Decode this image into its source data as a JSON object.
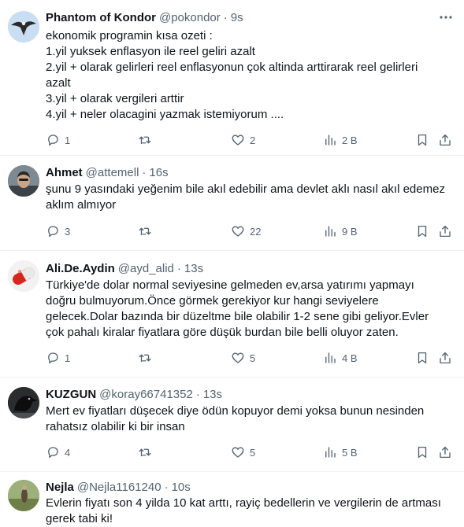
{
  "icons": {
    "more": "more-dots-icon",
    "reply": "reply-bubble-icon",
    "retweet": "retweet-icon",
    "like": "heart-icon",
    "views": "views-bars-icon",
    "bookmark": "bookmark-icon",
    "share": "share-upload-icon"
  },
  "colors": {
    "text": "#0f1419",
    "muted": "#536471",
    "divider": "#eff3f4"
  },
  "tweets": [
    {
      "name": "Phantom of Kondor",
      "handle": "@pokondor",
      "separator": "·",
      "time": "9s",
      "lines": [
        "ekonomik programin kısa ozeti :",
        "1.yil yuksek enflasyon ile reel geliri azalt",
        "2.yil + olarak gelirleri reel enflasyonun çok altinda arttirarak reel gelirleri",
        "azalt",
        "3.yil + olarak vergileri arttir",
        "4.yil + neler olacagini yazmak istemiyorum ...."
      ],
      "replies": "1",
      "retweets": "",
      "likes": "2",
      "views": "2 B"
    },
    {
      "name": "Ahmet",
      "handle": "@attemell",
      "separator": "·",
      "time": "16s",
      "lines": [
        "şunu 9 yasındaki yeğenim bile akıl edebilir ama devlet aklı nasıl akıl edemez",
        "aklım almıyor"
      ],
      "replies": "3",
      "retweets": "",
      "likes": "22",
      "views": "9 B"
    },
    {
      "name": "Ali.De.Aydin",
      "handle": "@ayd_alid",
      "separator": "·",
      "time": "13s",
      "lines": [
        "Türkiye'de dolar normal seviyesine gelmeden ev,arsa yatırımı yapmayı",
        "doğru bulmuyorum.Önce görmek gerekiyor kur hangi seviyelere",
        "gelecek.Dolar bazında bir düzeltme bile olabilir 1-2 sene gibi geliyor.Evler",
        "çok pahalı kiralar fiyatlara göre düşük burdan bile belli oluyor zaten."
      ],
      "replies": "1",
      "retweets": "",
      "likes": "5",
      "views": "4 B"
    },
    {
      "name": "KUZGUN",
      "handle": "@koray66741352",
      "separator": "·",
      "time": "13s",
      "lines": [
        "Mert ev fiyatları düşecek diye ödün kopuyor demi yoksa bunun nesinden",
        "rahatsız olabilir ki bir insan"
      ],
      "replies": "4",
      "retweets": "",
      "likes": "5",
      "views": "5 B"
    },
    {
      "name": "Nejla",
      "handle": "@Nejla1161240",
      "separator": "·",
      "time": "10s",
      "lines": [
        "Evlerin fiyatı son 4 yilda 10 kat arttı,  rayiç bedellerin ve vergilerin de artması",
        "gerek tabi ki!"
      ]
    }
  ]
}
